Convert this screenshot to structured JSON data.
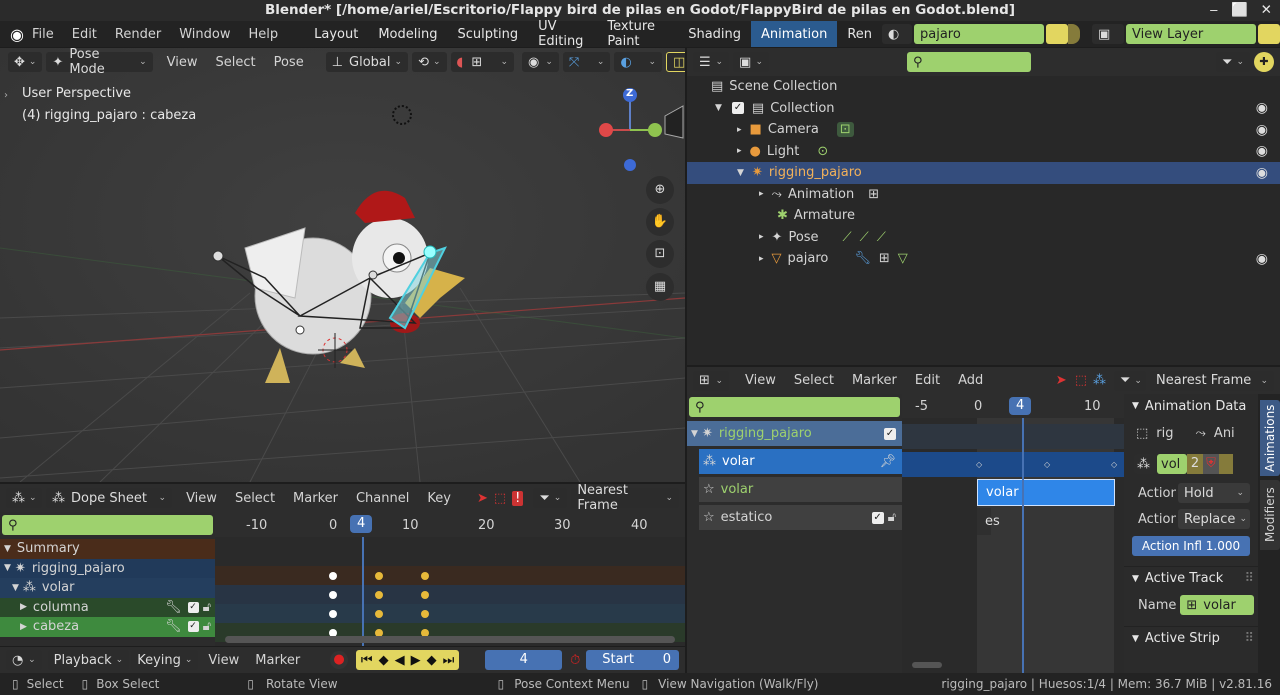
{
  "title": "Blender* [/home/ariel/Escritorio/Flappy bird de pilas en Godot/FlappyBird de pilas en Godot.blend]",
  "menu": [
    "File",
    "Edit",
    "Render",
    "Window",
    "Help"
  ],
  "workspaces": [
    "Layout",
    "Modeling",
    "Sculpting",
    "UV Editing",
    "Texture Paint",
    "Shading",
    "Animation",
    "Ren"
  ],
  "scene_name": "pajaro",
  "view_layer": "View Layer",
  "viewport": {
    "mode": "Pose Mode",
    "menus": [
      "View",
      "Select",
      "Pose"
    ],
    "transform": "Global",
    "info1": "User Perspective",
    "info2": "(4) rigging_pajaro : cabeza",
    "gizmo_z": "Z"
  },
  "outliner": {
    "scene_collection": "Scene Collection",
    "collection": "Collection",
    "camera": "Camera",
    "light": "Light",
    "rig": "rigging_pajaro",
    "animation": "Animation",
    "armature": "Armature",
    "pose": "Pose",
    "mesh": "pajaro"
  },
  "nla": {
    "menus": [
      "View",
      "Select",
      "Marker",
      "Edit",
      "Add"
    ],
    "snap": "Nearest Frame",
    "ruler": [
      "-5",
      "0",
      "4",
      "10"
    ],
    "tracks": {
      "rig": "rigging_pajaro",
      "action_row": "volar",
      "track1": "volar",
      "track2": "estatico"
    },
    "strip1": "volar",
    "strip2": "es"
  },
  "props": {
    "animation_data": "Animation Data",
    "rig_label": "rig",
    "ani_label": "Ani",
    "action_name": "vol",
    "users": "2",
    "extrapolation_label": "Action",
    "extrapolation": "Hold",
    "blending_label": "Action",
    "blending": "Replace",
    "influence": "Action Infl  1.000",
    "active_track": "Active Track",
    "name_label": "Name",
    "track_name": "volar",
    "active_strip": "Active Strip",
    "tab1": "Animations",
    "tab2": "Modifiers"
  },
  "dopesheet": {
    "mode": "Dope Sheet",
    "menus": [
      "View",
      "Select",
      "Marker",
      "Channel",
      "Key"
    ],
    "snap": "Nearest Frame",
    "ruler": [
      "-10",
      "0",
      "4",
      "10",
      "20",
      "30",
      "40"
    ],
    "channels": {
      "summary": "Summary",
      "rig": "rigging_pajaro",
      "action": "volar",
      "bone1": "columna",
      "bone2": "cabeza"
    }
  },
  "timeline": {
    "menus": [
      "Playback",
      "Keying",
      "View",
      "Marker"
    ],
    "frame": "4",
    "start_label": "Start",
    "start": "0"
  },
  "status": {
    "select": "Select",
    "box": "Box Select",
    "rotate": "Rotate View",
    "ctx": "Pose Context Menu",
    "nav": "View Navigation (Walk/Fly)",
    "info": "rigging_pajaro | Huesos:1/4  | Mem: 36.7 MiB | v2.81.16"
  },
  "colors": {
    "accent": "#4772b3",
    "green": "#9ed16e",
    "keyframe": "#e7b93a"
  }
}
